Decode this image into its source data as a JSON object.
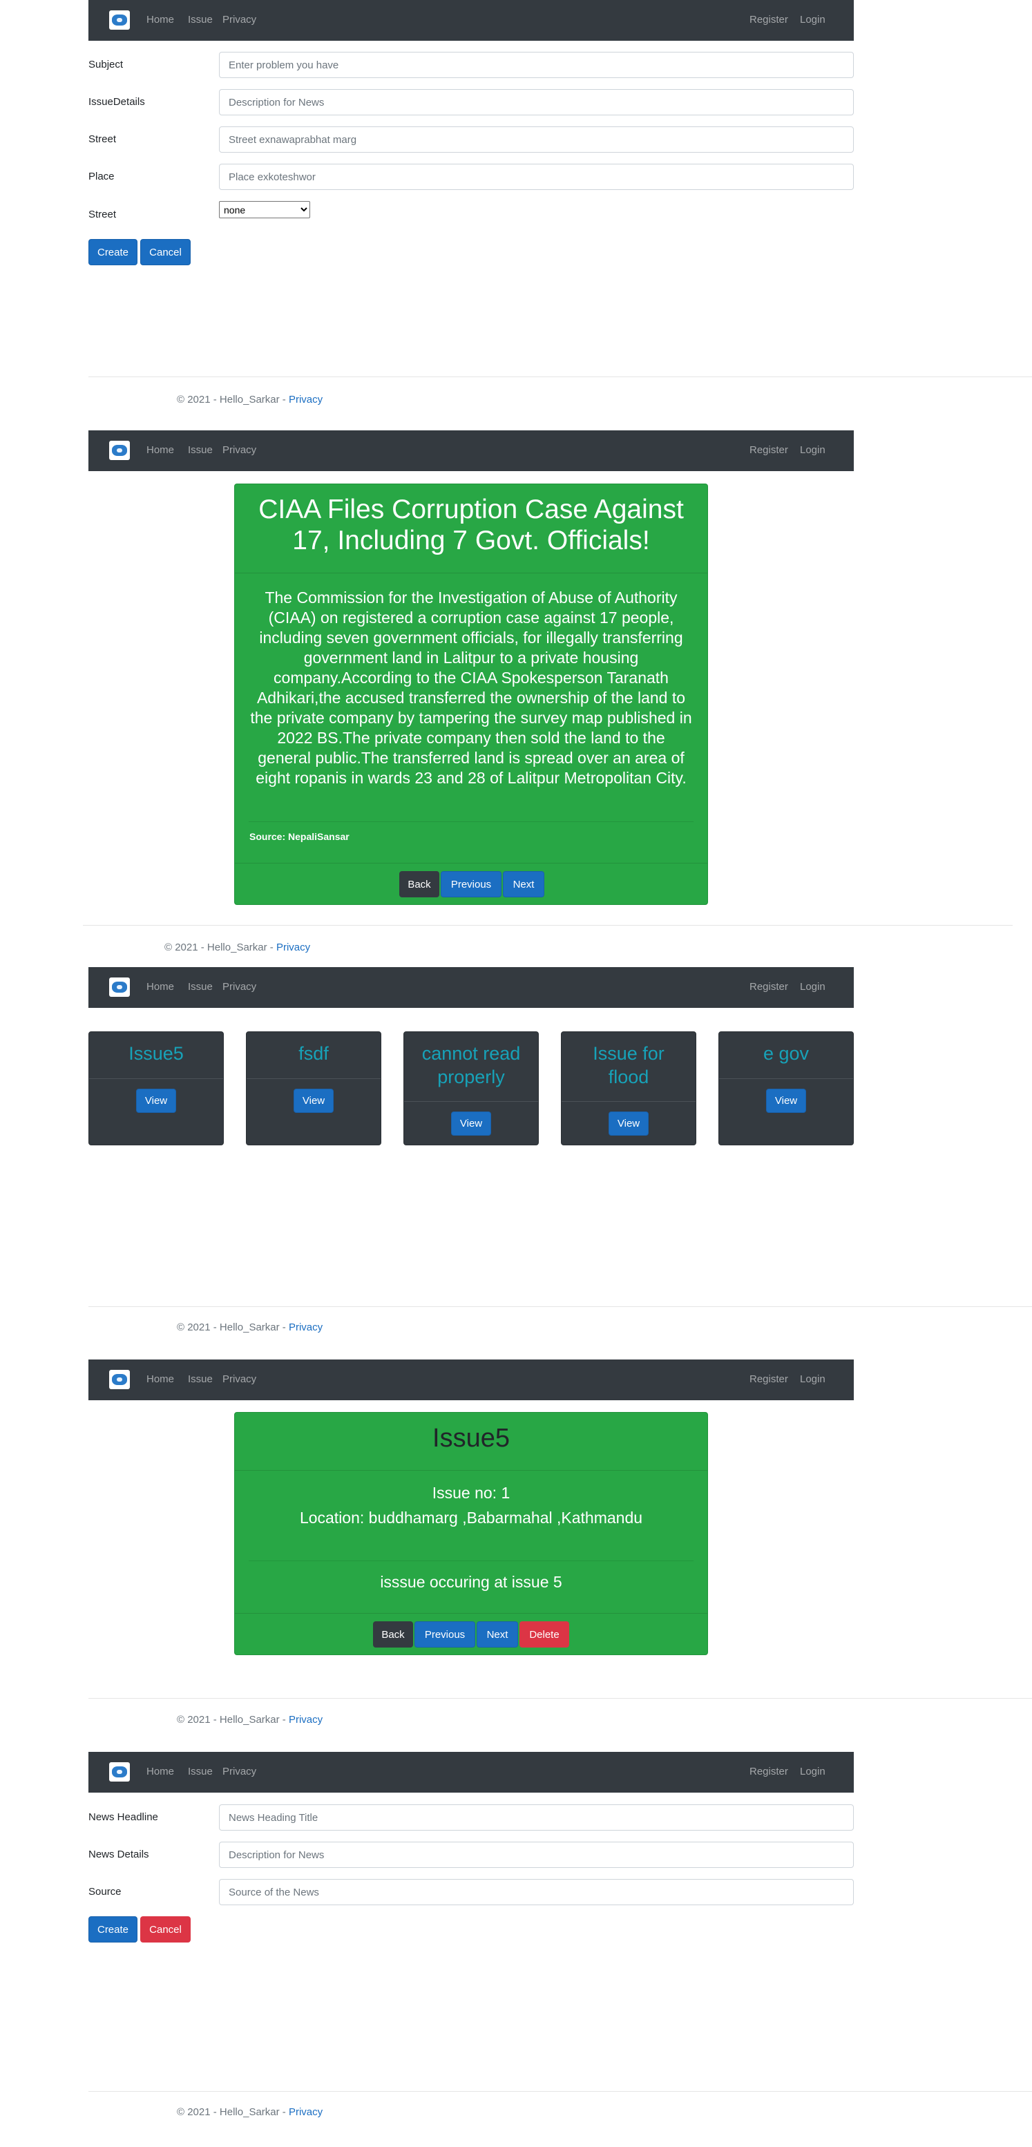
{
  "nav": {
    "home": "Home",
    "issue": "Issue",
    "privacy": "Privacy",
    "register": "Register",
    "login": "Login"
  },
  "footer": {
    "text": "© 2021 - Hello_Sarkar - ",
    "link": "Privacy"
  },
  "issue_form": {
    "subject_label": "Subject",
    "subject_placeholder": "Enter problem you have",
    "details_label": "IssueDetails",
    "details_placeholder": "Description for News",
    "street_label": "Street",
    "street_placeholder": "Street exnawaprabhat marg",
    "place_label": "Place",
    "place_placeholder": "Place exkoteshwor",
    "select_label": "Street",
    "select_value": "none",
    "create": "Create",
    "cancel": "Cancel"
  },
  "news_detail": {
    "title": "CIAA Files Corruption Case Against 17, Including 7 Govt. Officials!",
    "body": "The Commission for the Investigation of Abuse of Authority (CIAA) on registered a corruption case against 17 people, including seven government officials, for illegally transferring government land in Lalitpur to a private housing company.According to the CIAA Spokesperson Taranath Adhikari,the accused transferred the ownership of the land to the private company by tampering the survey map published in 2022 BS.The private company then sold the land to the general public.The transferred land is spread over an area of eight ropanis in wards 23 and 28 of Lalitpur Metropolitan City.",
    "source": "Source: NepaliSansar",
    "back": "Back",
    "previous": "Previous",
    "next": "Next"
  },
  "issue_list": {
    "cards": [
      {
        "title": "Issue5",
        "button": "View"
      },
      {
        "title": "fsdf",
        "button": "View"
      },
      {
        "title": "cannot read properly",
        "button": "View"
      },
      {
        "title": "Issue for flood",
        "button": "View"
      },
      {
        "title": "e gov",
        "button": "View"
      }
    ]
  },
  "issue_detail": {
    "title": "Issue5",
    "issue_no": "Issue no: 1",
    "location": "Location: buddhamarg ,Babarmahal ,Kathmandu",
    "description": "isssue occuring at issue 5",
    "back": "Back",
    "previous": "Previous",
    "next": "Next",
    "delete": "Delete"
  },
  "news_form": {
    "headline_label": "News Headline",
    "headline_placeholder": "News Heading Title",
    "details_label": "News Details",
    "details_placeholder": "Description for News",
    "source_label": "Source",
    "source_placeholder": "Source of the News",
    "create": "Create",
    "cancel": "Cancel"
  },
  "colors": {
    "navbar": "#343a40",
    "primary": "#1b6ec2",
    "success": "#28a745",
    "danger": "#dc3545",
    "info": "#17a2b8"
  }
}
